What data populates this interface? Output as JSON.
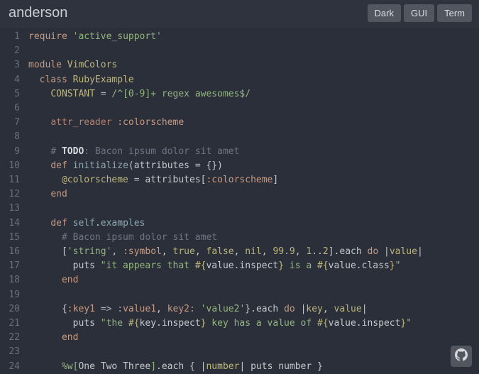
{
  "header": {
    "title": "anderson",
    "buttons": {
      "dark": "Dark",
      "gui": "GUI",
      "term": "Term"
    }
  },
  "code": {
    "lines": [
      [
        {
          "t": "t-keyword",
          "s": "require"
        },
        {
          "t": "t-fg",
          "s": " "
        },
        {
          "t": "t-string",
          "s": "'active_support'"
        }
      ],
      [],
      [
        {
          "t": "t-keyword",
          "s": "module"
        },
        {
          "t": "t-fg",
          "s": " "
        },
        {
          "t": "t-constant",
          "s": "VimColors"
        }
      ],
      [
        {
          "t": "t-fg",
          "s": "  "
        },
        {
          "t": "t-keyword",
          "s": "class"
        },
        {
          "t": "t-fg",
          "s": " "
        },
        {
          "t": "t-constant",
          "s": "RubyExample"
        }
      ],
      [
        {
          "t": "t-fg",
          "s": "    "
        },
        {
          "t": "t-constant",
          "s": "CONSTANT"
        },
        {
          "t": "t-fg",
          "s": " "
        },
        {
          "t": "t-op",
          "s": "="
        },
        {
          "t": "t-fg",
          "s": " "
        },
        {
          "t": "t-string",
          "s": "/^[0-9]+ regex awesomes$/"
        }
      ],
      [],
      [
        {
          "t": "t-fg",
          "s": "    "
        },
        {
          "t": "t-attr",
          "s": "attr_reader"
        },
        {
          "t": "t-fg",
          "s": " "
        },
        {
          "t": "t-symbol",
          "s": ":colorscheme"
        }
      ],
      [],
      [
        {
          "t": "t-fg",
          "s": "    "
        },
        {
          "t": "t-comment",
          "s": "# "
        },
        {
          "t": "t-todo",
          "s": "TODO"
        },
        {
          "t": "t-comment",
          "s": ": Bacon ipsum dolor sit amet"
        }
      ],
      [
        {
          "t": "t-fg",
          "s": "    "
        },
        {
          "t": "t-keyword",
          "s": "def"
        },
        {
          "t": "t-fg",
          "s": " "
        },
        {
          "t": "t-method",
          "s": "initialize"
        },
        {
          "t": "t-punct",
          "s": "("
        },
        {
          "t": "t-fg",
          "s": "attributes "
        },
        {
          "t": "t-op",
          "s": "="
        },
        {
          "t": "t-fg",
          "s": " "
        },
        {
          "t": "t-punct",
          "s": "{})"
        }
      ],
      [
        {
          "t": "t-fg",
          "s": "      "
        },
        {
          "t": "t-ivar",
          "s": "@colorscheme"
        },
        {
          "t": "t-fg",
          "s": " "
        },
        {
          "t": "t-op",
          "s": "="
        },
        {
          "t": "t-fg",
          "s": " attributes"
        },
        {
          "t": "t-punct",
          "s": "["
        },
        {
          "t": "t-symbol",
          "s": ":colorscheme"
        },
        {
          "t": "t-punct",
          "s": "]"
        }
      ],
      [
        {
          "t": "t-fg",
          "s": "    "
        },
        {
          "t": "t-keyword",
          "s": "end"
        }
      ],
      [],
      [
        {
          "t": "t-fg",
          "s": "    "
        },
        {
          "t": "t-keyword",
          "s": "def"
        },
        {
          "t": "t-fg",
          "s": " "
        },
        {
          "t": "t-method",
          "s": "self"
        },
        {
          "t": "t-punct",
          "s": "."
        },
        {
          "t": "t-method",
          "s": "examples"
        }
      ],
      [
        {
          "t": "t-fg",
          "s": "      "
        },
        {
          "t": "t-comment",
          "s": "# Bacon ipsum dolor sit amet"
        }
      ],
      [
        {
          "t": "t-fg",
          "s": "      "
        },
        {
          "t": "t-punct",
          "s": "["
        },
        {
          "t": "t-string",
          "s": "'string'"
        },
        {
          "t": "t-punct",
          "s": ", "
        },
        {
          "t": "t-symbol",
          "s": ":symbol"
        },
        {
          "t": "t-punct",
          "s": ", "
        },
        {
          "t": "t-bool",
          "s": "true"
        },
        {
          "t": "t-punct",
          "s": ", "
        },
        {
          "t": "t-bool",
          "s": "false"
        },
        {
          "t": "t-punct",
          "s": ", "
        },
        {
          "t": "t-bool",
          "s": "nil"
        },
        {
          "t": "t-punct",
          "s": ", "
        },
        {
          "t": "t-number",
          "s": "99.9"
        },
        {
          "t": "t-punct",
          "s": ", "
        },
        {
          "t": "t-number",
          "s": "1"
        },
        {
          "t": "t-punct",
          "s": ".."
        },
        {
          "t": "t-number",
          "s": "2"
        },
        {
          "t": "t-punct",
          "s": "]."
        },
        {
          "t": "t-fg",
          "s": "each "
        },
        {
          "t": "t-keyword",
          "s": "do"
        },
        {
          "t": "t-fg",
          "s": " "
        },
        {
          "t": "t-punct",
          "s": "|"
        },
        {
          "t": "t-constant",
          "s": "value"
        },
        {
          "t": "t-punct",
          "s": "|"
        }
      ],
      [
        {
          "t": "t-fg",
          "s": "        puts "
        },
        {
          "t": "t-string",
          "s": "\"it appears that "
        },
        {
          "t": "t-special",
          "s": "#{"
        },
        {
          "t": "t-fg",
          "s": "value.inspect"
        },
        {
          "t": "t-special",
          "s": "}"
        },
        {
          "t": "t-string",
          "s": " is a "
        },
        {
          "t": "t-special",
          "s": "#{"
        },
        {
          "t": "t-fg",
          "s": "value.class"
        },
        {
          "t": "t-special",
          "s": "}"
        },
        {
          "t": "t-string",
          "s": "\""
        }
      ],
      [
        {
          "t": "t-fg",
          "s": "      "
        },
        {
          "t": "t-keyword",
          "s": "end"
        }
      ],
      [],
      [
        {
          "t": "t-fg",
          "s": "      "
        },
        {
          "t": "t-punct",
          "s": "{"
        },
        {
          "t": "t-symbol",
          "s": ":key1"
        },
        {
          "t": "t-fg",
          "s": " "
        },
        {
          "t": "t-op",
          "s": "=>"
        },
        {
          "t": "t-fg",
          "s": " "
        },
        {
          "t": "t-symbol",
          "s": ":value1"
        },
        {
          "t": "t-punct",
          "s": ", "
        },
        {
          "t": "t-symbol",
          "s": "key2:"
        },
        {
          "t": "t-fg",
          "s": " "
        },
        {
          "t": "t-string",
          "s": "'value2'"
        },
        {
          "t": "t-punct",
          "s": "}."
        },
        {
          "t": "t-fg",
          "s": "each "
        },
        {
          "t": "t-keyword",
          "s": "do"
        },
        {
          "t": "t-fg",
          "s": " "
        },
        {
          "t": "t-punct",
          "s": "|"
        },
        {
          "t": "t-constant",
          "s": "key"
        },
        {
          "t": "t-punct",
          "s": ", "
        },
        {
          "t": "t-constant",
          "s": "value"
        },
        {
          "t": "t-punct",
          "s": "|"
        }
      ],
      [
        {
          "t": "t-fg",
          "s": "        puts "
        },
        {
          "t": "t-string",
          "s": "\"the "
        },
        {
          "t": "t-special",
          "s": "#{"
        },
        {
          "t": "t-fg",
          "s": "key.inspect"
        },
        {
          "t": "t-special",
          "s": "}"
        },
        {
          "t": "t-string",
          "s": " key has a value of "
        },
        {
          "t": "t-special",
          "s": "#{"
        },
        {
          "t": "t-fg",
          "s": "value.inspect"
        },
        {
          "t": "t-special",
          "s": "}"
        },
        {
          "t": "t-string",
          "s": "\""
        }
      ],
      [
        {
          "t": "t-fg",
          "s": "      "
        },
        {
          "t": "t-keyword",
          "s": "end"
        }
      ],
      [],
      [
        {
          "t": "t-fg",
          "s": "      "
        },
        {
          "t": "t-string",
          "s": "%w["
        },
        {
          "t": "t-fg",
          "s": "One Two Three"
        },
        {
          "t": "t-string",
          "s": "]"
        },
        {
          "t": "t-punct",
          "s": "."
        },
        {
          "t": "t-fg",
          "s": "each "
        },
        {
          "t": "t-punct",
          "s": "{ |"
        },
        {
          "t": "t-constant",
          "s": "number"
        },
        {
          "t": "t-punct",
          "s": "|"
        },
        {
          "t": "t-fg",
          "s": " puts number "
        },
        {
          "t": "t-punct",
          "s": "}"
        }
      ]
    ]
  }
}
